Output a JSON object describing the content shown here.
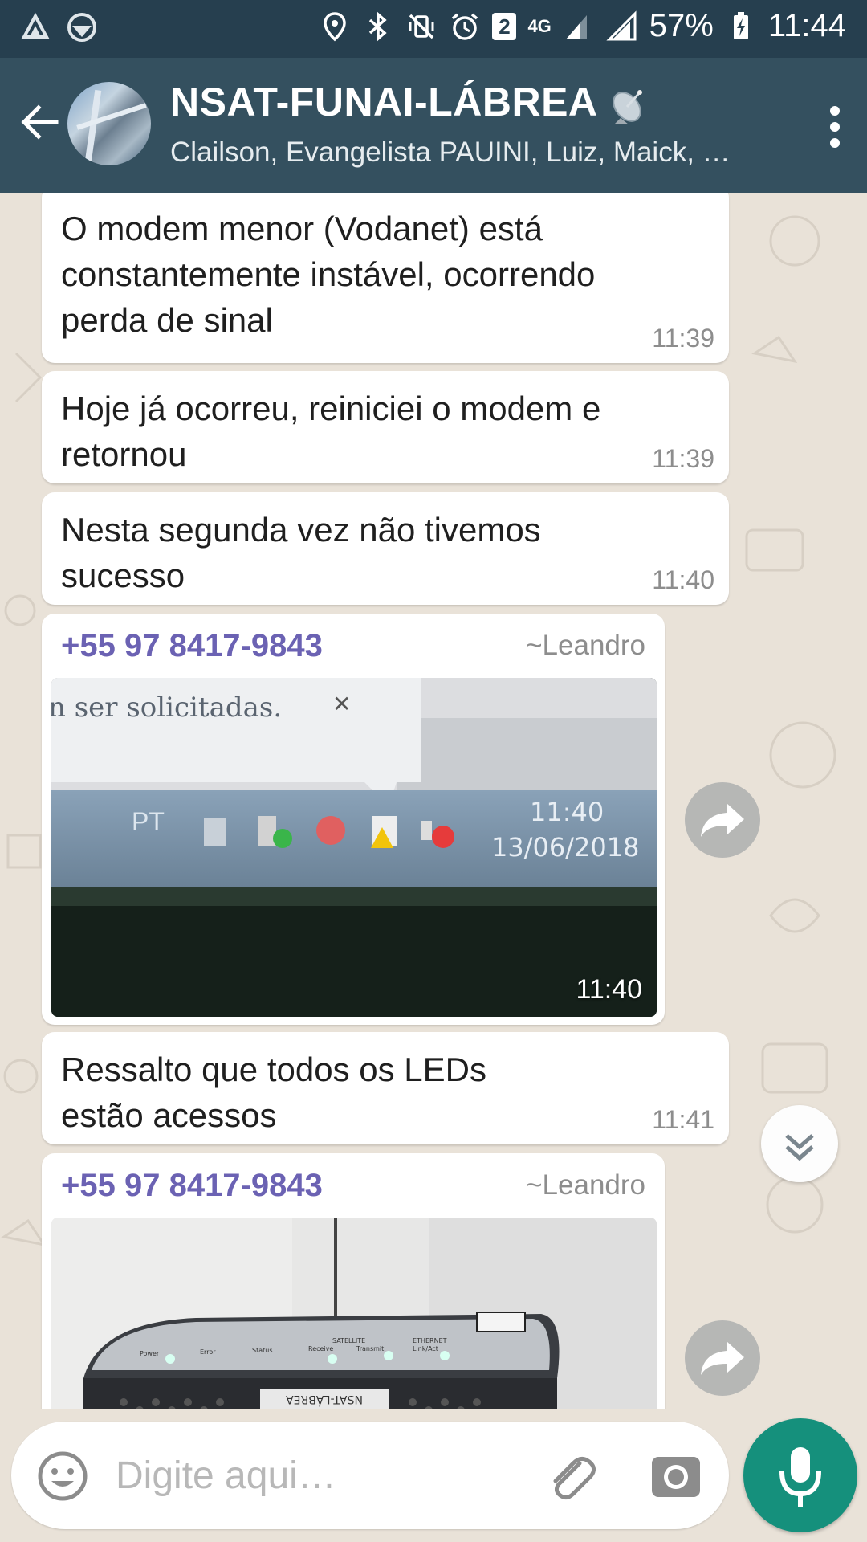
{
  "status_bar": {
    "sim_badge": "2",
    "network": "4G",
    "battery": "57%",
    "time": "11:44"
  },
  "header": {
    "title": "NSAT-FUNAI-LÁBREA",
    "members": "Clailson, Evangelista PAUINI, Luiz, Maick, …"
  },
  "messages": [
    {
      "type": "text",
      "text": "O modem menor (Vodanet) está constantemente instável, ocorrendo perda de sinal",
      "time": "11:39"
    },
    {
      "type": "text",
      "text": "Hoje já ocorreu, reiniciei o modem e retornou",
      "time": "11:39"
    },
    {
      "type": "text",
      "text": "Nesta segunda vez não tivemos sucesso",
      "time": "11:40"
    },
    {
      "type": "image",
      "sender": "+55 97 8417-9843",
      "alias": "~Leandro",
      "time": "11:40",
      "image_text": {
        "popup": "n ser solicitadas.",
        "lang": "PT",
        "clock": "11:40",
        "date": "13/06/2018"
      }
    },
    {
      "type": "text",
      "text": "Ressalto que todos os LEDs estão acessos",
      "time": "11:41"
    },
    {
      "type": "image",
      "sender": "+55 97 8417-9843",
      "alias": "~Leandro",
      "image_text": {
        "labels": [
          "Power",
          "Error",
          "Status",
          "Receive",
          "SATELLITE",
          "Transmit",
          "ETHERNET",
          "Link/Act"
        ],
        "device_label": "NSAT-LÁBREA"
      }
    }
  ],
  "composer": {
    "placeholder": "Digite aqui…"
  },
  "colors": {
    "header": "#34505f",
    "status_bar": "#263f4f",
    "sender_name": "#6b62b3",
    "mic_button": "#15907c",
    "chat_background": "#e9e2d8"
  },
  "icons": [
    "back-arrow-icon",
    "satellite-dish-icon",
    "more-vert-icon",
    "forward-icon",
    "chevron-down-icon",
    "emoji-icon",
    "attach-icon",
    "camera-icon",
    "mic-icon"
  ]
}
